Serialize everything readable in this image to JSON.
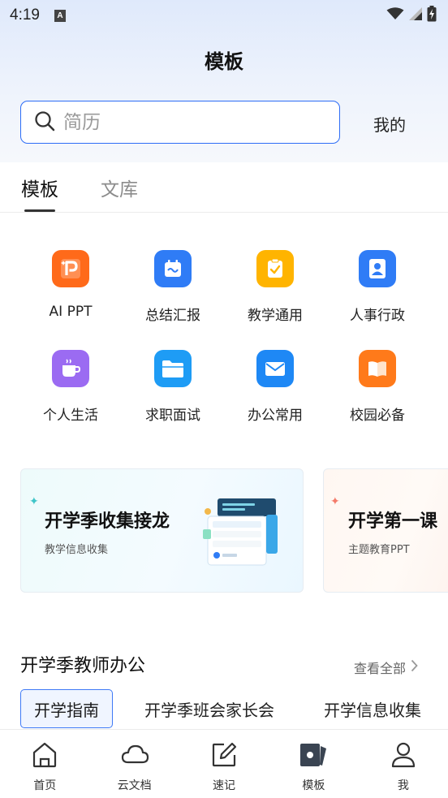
{
  "status_bar": {
    "time": "4:19",
    "notification_icon": "a-notification-icon",
    "wifi_icon": "wifi-icon",
    "signal_icon": "signal-icon",
    "battery_icon": "battery-charging-icon"
  },
  "header": {
    "title": "模板"
  },
  "search": {
    "placeholder": "简历",
    "icon": "search-icon"
  },
  "mine_link": "我的",
  "tabs": [
    {
      "label": "模板",
      "active": true
    },
    {
      "label": "文库",
      "active": false
    }
  ],
  "categories": [
    {
      "label": "AI PPT",
      "icon": "ppt-icon",
      "color": "#ff6a1a"
    },
    {
      "label": "总结汇报",
      "icon": "report-calendar-icon",
      "color": "#2f7cf6"
    },
    {
      "label": "教学通用",
      "icon": "teaching-check-icon",
      "color": "#ffb400"
    },
    {
      "label": "人事行政",
      "icon": "person-badge-icon",
      "color": "#2f7cf6"
    },
    {
      "label": "个人生活",
      "icon": "coffee-cup-icon",
      "color": "#9b6bf2"
    },
    {
      "label": "求职面试",
      "icon": "folder-icon",
      "color": "#1e9cf5"
    },
    {
      "label": "办公常用",
      "icon": "mail-icon",
      "color": "#1e88f5"
    },
    {
      "label": "校园必备",
      "icon": "book-icon",
      "color": "#ff7a1a"
    }
  ],
  "banners": [
    {
      "title": "开学季收集接龙",
      "subtitle": "教学信息收集"
    },
    {
      "title": "开学第一课",
      "subtitle": "主题教育PPT"
    }
  ],
  "section": {
    "title": "开学季教师办公",
    "view_all": "查看全部"
  },
  "chips": [
    {
      "label": "开学指南",
      "active": true
    },
    {
      "label": "开学季班会家长会",
      "active": false
    },
    {
      "label": "开学信息收集",
      "active": false
    }
  ],
  "bottom_nav": [
    {
      "label": "首页",
      "icon": "home-icon"
    },
    {
      "label": "云文档",
      "icon": "cloud-icon"
    },
    {
      "label": "速记",
      "icon": "note-edit-icon"
    },
    {
      "label": "模板",
      "icon": "template-icon"
    },
    {
      "label": "我",
      "icon": "profile-icon"
    }
  ]
}
